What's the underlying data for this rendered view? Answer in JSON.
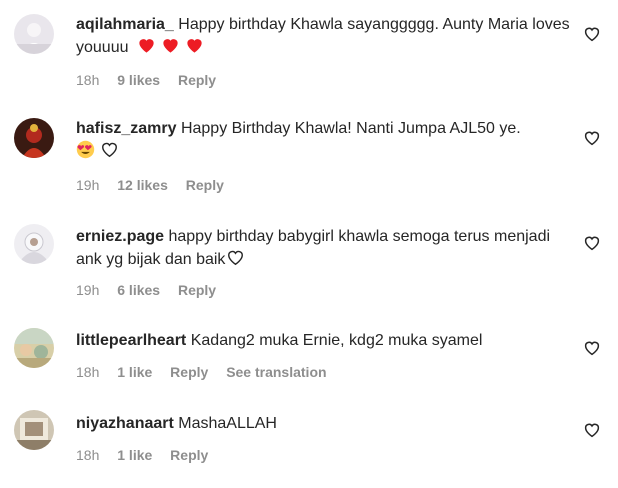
{
  "comments": [
    {
      "username": "aqilahmaria_",
      "text": "Happy birthday Khawla sayanggggg. Aunty Maria loves youuuu",
      "emojis": [
        "red-heart",
        "red-heart",
        "red-heart"
      ],
      "time": "18h",
      "likes": "9 likes",
      "reply": "Reply"
    },
    {
      "username": "hafisz_zamry",
      "text": "Happy Birthday Khawla! Nanti Jumpa AJL50 ye.",
      "emojis": [
        "heart-eyes-face",
        "white-heart"
      ],
      "time": "19h",
      "likes": "12 likes",
      "reply": "Reply"
    },
    {
      "username": "erniez.page",
      "text": "happy birthday babygirl khawla semoga terus menjadi ank yg bijak dan baik",
      "emojis": [
        "white-heart"
      ],
      "time": "19h",
      "likes": "6 likes",
      "reply": "Reply"
    },
    {
      "username": "littlepearlheart",
      "text": "Kadang2 muka Ernie, kdg2 muka syamel",
      "emojis": [],
      "time": "18h",
      "likes": "1 like",
      "reply": "Reply",
      "translation": "See translation"
    },
    {
      "username": "niyazhanaart",
      "text": "MashaALLAH",
      "emojis": [],
      "time": "18h",
      "likes": "1 like",
      "reply": "Reply"
    }
  ],
  "colors": {
    "text": "#262626",
    "secondary": "#8e8e8e",
    "heart_red": "#ed1c24"
  }
}
